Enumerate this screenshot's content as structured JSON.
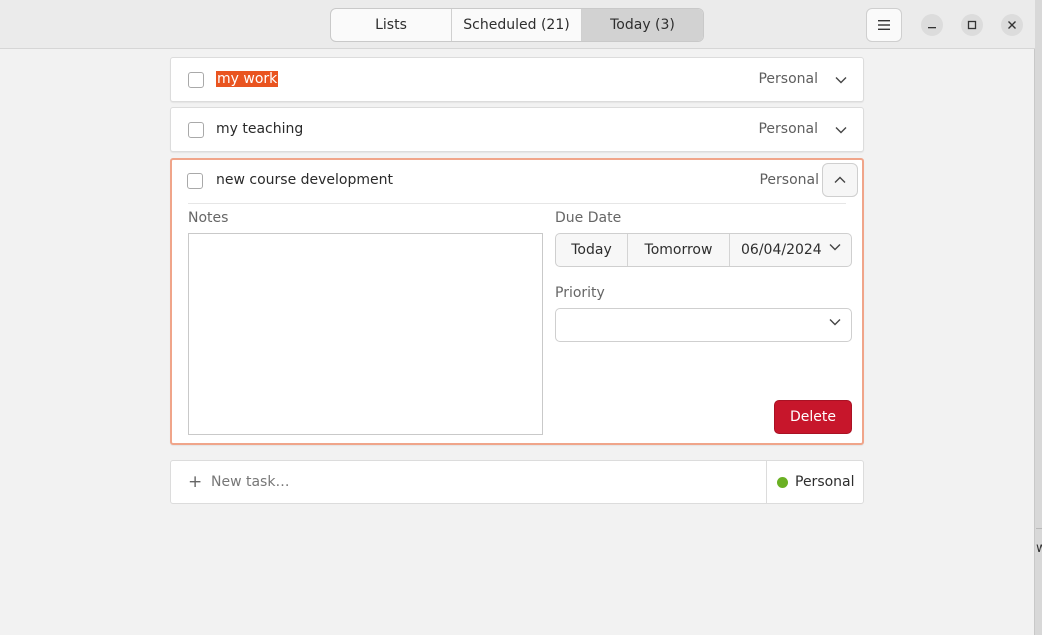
{
  "header": {
    "tabs": [
      {
        "label": "Lists",
        "active": false
      },
      {
        "label": "Scheduled (21)",
        "active": false
      },
      {
        "label": "Today (3)",
        "active": true
      }
    ],
    "menu_icon": "hamburger-menu-icon",
    "window_controls": [
      "minimize-icon",
      "maximize-icon",
      "close-icon"
    ]
  },
  "tasks": [
    {
      "title": "my work",
      "list": "Personal",
      "expanded": false,
      "selected_text": true
    },
    {
      "title": "my teaching",
      "list": "Personal",
      "expanded": false
    },
    {
      "title": "new course development",
      "list": "Personal",
      "expanded": true,
      "notes_label": "Notes",
      "notes_value": "",
      "due_date_label": "Due Date",
      "due_today": "Today",
      "due_tomorrow": "Tomorrow",
      "due_date_value": "06/04/2024",
      "priority_label": "Priority",
      "priority_value": "",
      "delete_label": "Delete"
    }
  ],
  "new_task": {
    "placeholder": "New task…",
    "list": "Personal",
    "list_color": "#6ab023"
  },
  "colors": {
    "accent": "#e95420",
    "delete": "#c7162b",
    "focus_border": "#f0a58a"
  },
  "edge_fragment": "w"
}
